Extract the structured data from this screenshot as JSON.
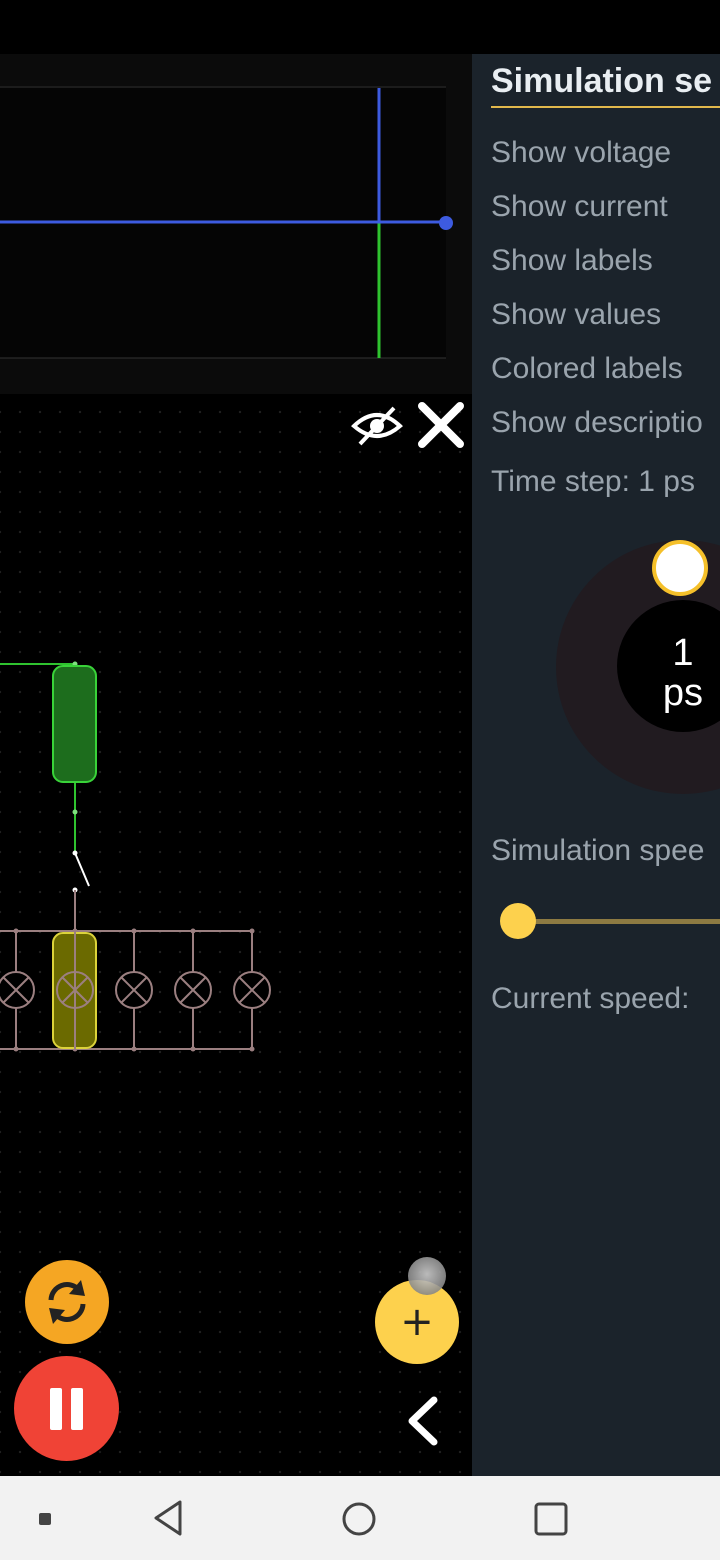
{
  "settings_panel": {
    "title": "Simulation se",
    "options": [
      {
        "label": "Show voltage"
      },
      {
        "label": "Show current"
      },
      {
        "label": "Show labels"
      },
      {
        "label": "Show values"
      },
      {
        "label": "Colored labels"
      },
      {
        "label": "Show descriptio"
      }
    ],
    "time_step_label": "Time step: 1 ps",
    "dial_value": "1",
    "dial_unit": "ps",
    "simulation_speed_label": "Simulation spee",
    "speed_fraction": 0,
    "current_speed_label": "Current speed:"
  },
  "colors": {
    "accent_yellow": "#fdd14d",
    "reset_orange": "#f5a623",
    "pause_red": "#f04336",
    "panel_bg": "#1b232b",
    "trace_blue": "#3d5be0",
    "trace_green": "#2fc32f"
  },
  "icons": {
    "scope_hide": "eye-off-icon",
    "scope_close": "close-icon",
    "reset": "refresh-icon",
    "pause": "pause-icon",
    "add": "plus-icon",
    "collapse": "chevron-left-icon",
    "nav": [
      "recents-dot-icon",
      "nav-back-icon",
      "nav-home-icon",
      "nav-overview-icon"
    ]
  }
}
